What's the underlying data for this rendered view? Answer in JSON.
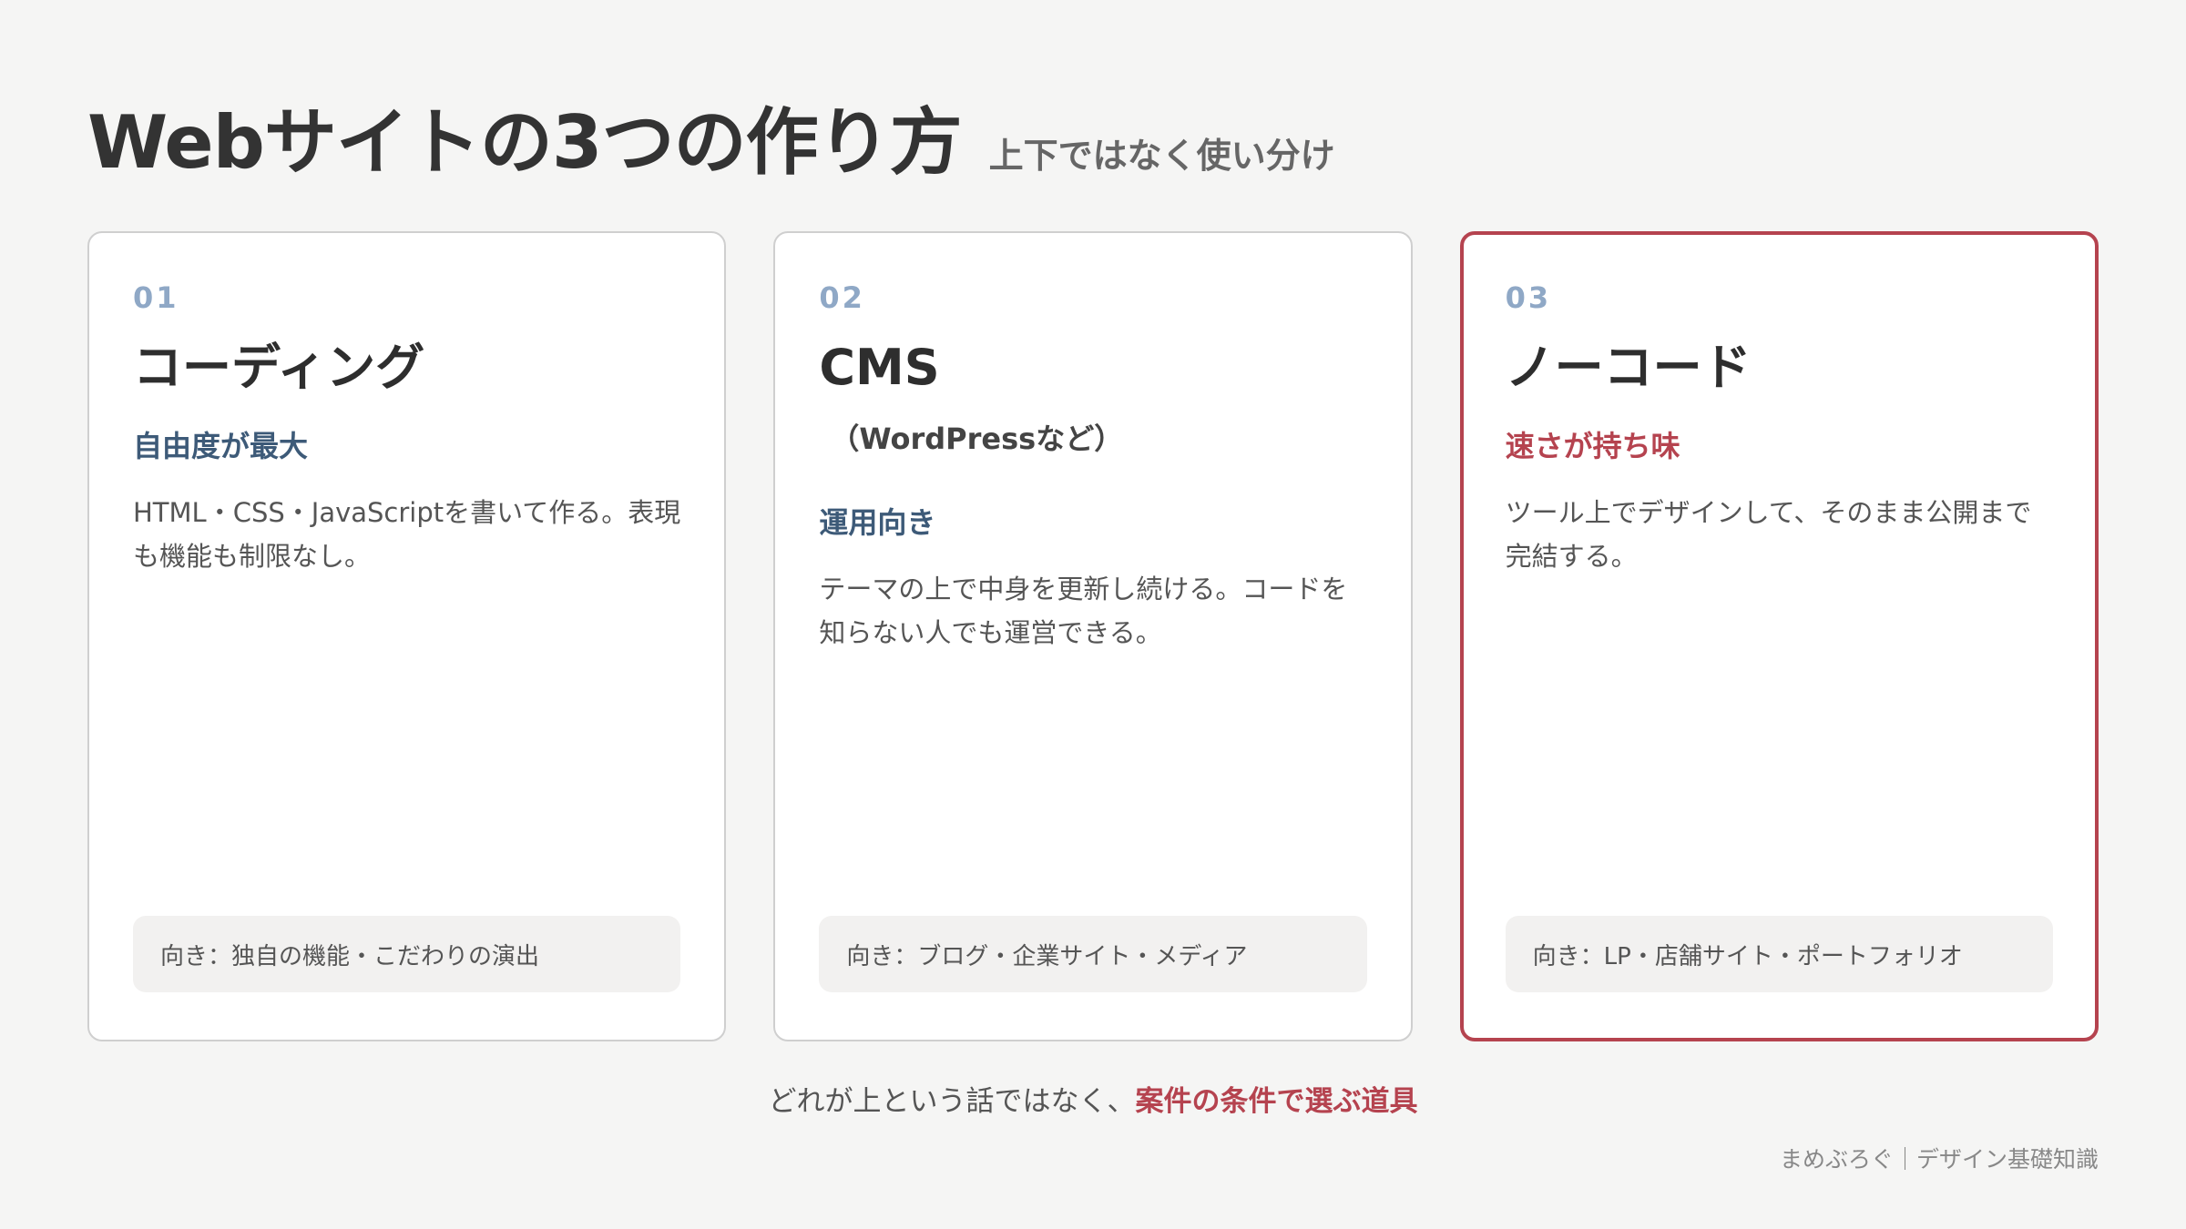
{
  "header": {
    "title": "Webサイトの3つの作り方",
    "subtitle": "上下ではなく使い分け"
  },
  "cards": [
    {
      "number": "01",
      "name": "コーディング",
      "tagline": "自由度が最大",
      "description": "HTML・CSS・JavaScriptを書いて作る。表現も機能も制限なし。",
      "suited_for": "向き：独自の機能・こだわりの演出"
    },
    {
      "number": "02",
      "name": "CMS",
      "sub_name": "（WordPressなど）",
      "tagline": "運用向き",
      "description": "テーマの上で中身を更新し続ける。コードを知らない人でも運営できる。",
      "suited_for": "向き：ブログ・企業サイト・メディア"
    },
    {
      "number": "03",
      "name": "ノーコード",
      "tagline": "速さが持ち味",
      "description": "ツール上でデザインして、そのまま公開まで完結する。",
      "suited_for": "向き：LP・店舗サイト・ポートフォリオ"
    }
  ],
  "footer": {
    "note_prefix": "どれが上という話ではなく、",
    "note_emphasis": "案件の条件で選ぶ道具",
    "credit": "まめぶろぐ｜デザイン基礎知識"
  },
  "colors": {
    "accent": "#b5434f",
    "navy": "#3d5a78",
    "number": "#8fa8c6",
    "background": "#f5f5f4"
  }
}
